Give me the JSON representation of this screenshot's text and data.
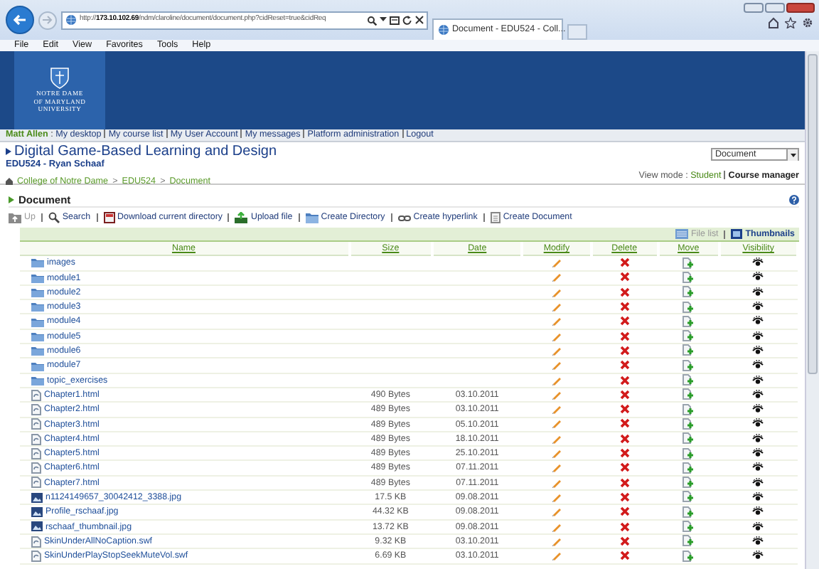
{
  "browser": {
    "address": "http://**173.10.102.69**/ndm/claroline/document/document.php?cidReset=true&cidReq",
    "tab_title": "Document - EDU524 - Coll...",
    "menu": [
      "File",
      "Edit",
      "View",
      "Favorites",
      "Tools",
      "Help"
    ]
  },
  "banner": {
    "logo_lines": [
      "NOTRE DAME",
      "OF MARYLAND",
      "UNIVERSITY"
    ]
  },
  "user_bar": {
    "user": "Matt Allen",
    "user_separator": ":",
    "links": [
      "My desktop",
      "My course list",
      "My User Account",
      "My messages",
      "Platform administration",
      "Logout"
    ]
  },
  "course": {
    "title": "Digital Game-Based Learning and Design",
    "subtitle": "EDU524 - Ryan Schaaf",
    "tool_select": "Document",
    "breadcrumb": [
      "College of Notre Dame",
      "EDU524",
      "Document"
    ],
    "breadcrumb_separators": [
      ">",
      ">"
    ],
    "view_mode_label": "View mode :",
    "view_modes": [
      {
        "label": "Student",
        "selected": false
      },
      {
        "label": "Course manager",
        "selected": true
      }
    ]
  },
  "section": {
    "title": "Document",
    "toolbar": [
      {
        "kind": "up",
        "label": "Up",
        "disabled": true
      },
      {
        "kind": "search",
        "label": "Search",
        "disabled": false
      },
      {
        "kind": "download",
        "label": "Download current directory",
        "disabled": false
      },
      {
        "kind": "upload",
        "label": "Upload file",
        "disabled": false
      },
      {
        "kind": "directory",
        "label": "Create Directory",
        "disabled": false
      },
      {
        "kind": "hyperlink",
        "label": "Create hyperlink",
        "disabled": false
      },
      {
        "kind": "document",
        "label": "Create Document",
        "disabled": false
      }
    ],
    "display_modes": [
      {
        "kind": "list",
        "label": "File list",
        "selected": true
      },
      {
        "kind": "thumbnails",
        "label": "Thumbnails",
        "selected": false
      }
    ]
  },
  "table": {
    "columns": [
      "Name",
      "Size",
      "Date",
      "Modify",
      "Delete",
      "Move",
      "Visibility"
    ],
    "rows": [
      {
        "kind": "folder",
        "name": "images"
      },
      {
        "kind": "folder",
        "name": "module1"
      },
      {
        "kind": "folder",
        "name": "module2"
      },
      {
        "kind": "folder",
        "name": "module3"
      },
      {
        "kind": "folder",
        "name": "module4"
      },
      {
        "kind": "folder",
        "name": "module5"
      },
      {
        "kind": "folder",
        "name": "module6"
      },
      {
        "kind": "folder",
        "name": "module7"
      },
      {
        "kind": "folder",
        "name": "topic_exercises"
      },
      {
        "kind": "file",
        "name": "Chapter1.html",
        "size": "490 Bytes",
        "date": "03.10.2011"
      },
      {
        "kind": "file",
        "name": "Chapter2.html",
        "size": "489 Bytes",
        "date": "03.10.2011"
      },
      {
        "kind": "file",
        "name": "Chapter3.html",
        "size": "489 Bytes",
        "date": "05.10.2011"
      },
      {
        "kind": "file",
        "name": "Chapter4.html",
        "size": "489 Bytes",
        "date": "18.10.2011"
      },
      {
        "kind": "file",
        "name": "Chapter5.html",
        "size": "489 Bytes",
        "date": "25.10.2011"
      },
      {
        "kind": "file",
        "name": "Chapter6.html",
        "size": "489 Bytes",
        "date": "07.11.2011"
      },
      {
        "kind": "file",
        "name": "Chapter7.html",
        "size": "489 Bytes",
        "date": "07.11.2011"
      },
      {
        "kind": "image",
        "name": "n1124149657_30042412_3388.jpg",
        "size": "17.5 KB",
        "date": "09.08.2011"
      },
      {
        "kind": "image",
        "name": "Profile_rschaaf.jpg",
        "size": "44.32 KB",
        "date": "09.08.2011"
      },
      {
        "kind": "image",
        "name": "rschaaf_thumbnail.jpg",
        "size": "13.72 KB",
        "date": "09.08.2011"
      },
      {
        "kind": "file",
        "name": "SkinUnderAllNoCaption.swf",
        "size": "9.32 KB",
        "date": "03.10.2011"
      },
      {
        "kind": "file",
        "name": "SkinUnderPlayStopSeekMuteVol.swf",
        "size": "6.69 KB",
        "date": "03.10.2011"
      }
    ]
  }
}
